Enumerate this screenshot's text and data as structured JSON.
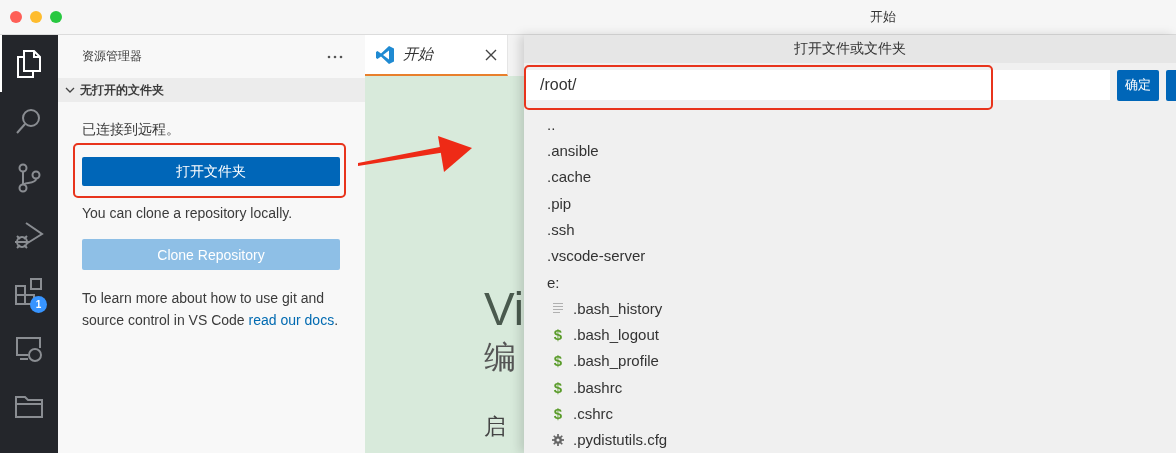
{
  "window": {
    "title": "开始"
  },
  "activity_bar": [
    {
      "kind": "explorer",
      "selected": true
    },
    {
      "kind": "search",
      "selected": false
    },
    {
      "kind": "source-control",
      "selected": false
    },
    {
      "kind": "run-debug",
      "selected": false
    },
    {
      "kind": "extensions",
      "selected": false,
      "badge": "1"
    },
    {
      "kind": "remote",
      "selected": false
    },
    {
      "kind": "folder",
      "selected": false
    }
  ],
  "sidebar": {
    "title": "资源管理器",
    "section": {
      "title": "无打开的文件夹",
      "expanded": true
    },
    "connected_text": "已连接到远程。",
    "open_folder_button": "打开文件夹",
    "clone_text": "You can clone a repository locally.",
    "clone_button": {
      "label": "Clone Repository",
      "disabled": true
    },
    "learn_text": "To learn more about how to use git and source control in VS Code",
    "learn_link": "read our docs",
    "learn_end": "."
  },
  "tabs": [
    {
      "label": "开始",
      "selected": true,
      "preview": true
    }
  ],
  "editor": {
    "heading": "Vi",
    "subheading": "编",
    "section_heading": "启"
  },
  "dialog": {
    "title": "打开文件或文件夹",
    "path": "/root/",
    "ok_button": "确定",
    "items": [
      {
        "kind": "folder",
        "label": ".."
      },
      {
        "kind": "folder",
        "label": ".ansible"
      },
      {
        "kind": "folder",
        "label": ".cache"
      },
      {
        "kind": "folder",
        "label": ".pip"
      },
      {
        "kind": "folder",
        "label": ".ssh"
      },
      {
        "kind": "folder",
        "label": ".vscode-server"
      },
      {
        "kind": "folder",
        "label": "e:"
      },
      {
        "kind": "text",
        "label": ".bash_history"
      },
      {
        "kind": "shell",
        "icon": "$",
        "label": ".bash_logout"
      },
      {
        "kind": "shell",
        "icon": "$",
        "label": ".bash_profile"
      },
      {
        "kind": "shell",
        "icon": "$",
        "label": ".bashrc"
      },
      {
        "kind": "shell",
        "icon": "$",
        "label": ".cshrc"
      },
      {
        "kind": "config",
        "label": ".pydistutils.cfg"
      }
    ]
  }
}
